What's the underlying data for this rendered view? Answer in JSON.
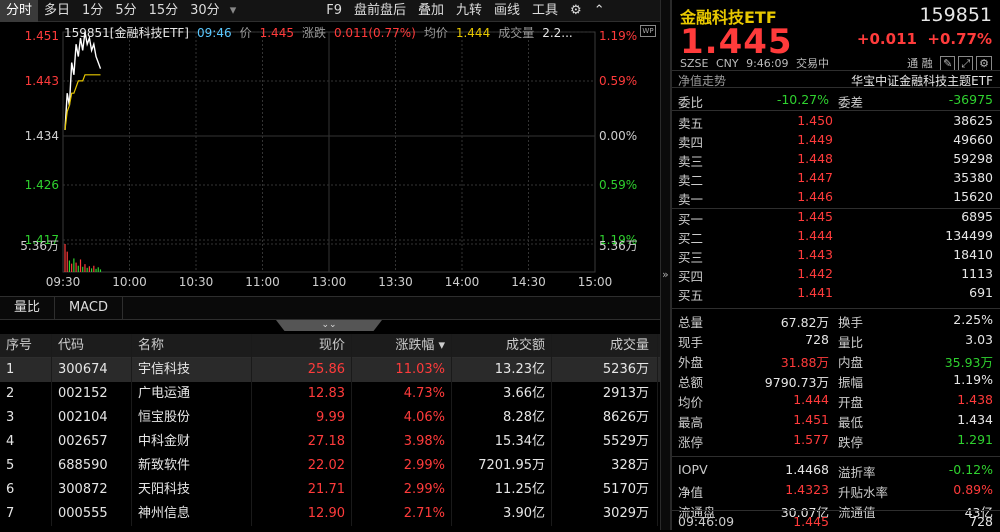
{
  "toolbar": {
    "items": [
      "分时",
      "多日",
      "1分",
      "5分",
      "15分",
      "30分",
      "▾",
      "F9",
      "盘前盘后",
      "叠加",
      "九转",
      "画线",
      "工具"
    ]
  },
  "chart": {
    "info": {
      "name": "159851[金融科技ETF]",
      "time": "09:46",
      "price_label": "价",
      "price": "1.445",
      "chg_label": "涨跌",
      "chg": "0.011(0.77%)",
      "avg_label": "均价",
      "avg": "1.444",
      "vol_label": "成交量",
      "vol": "2.2..."
    },
    "y_left": [
      "1.451",
      "1.443",
      "1.434",
      "1.426",
      "1.417",
      "5.36万"
    ],
    "y_right": [
      "1.19%",
      "0.59%",
      "0.00%",
      "0.59%",
      "1.19%",
      "5.36万"
    ],
    "x_labels": [
      "09:30",
      "10:00",
      "10:30",
      "11:00",
      "13:00",
      "13:30",
      "14:00",
      "14:30",
      "15:00"
    ],
    "wp_label": "WP"
  },
  "chart_data": {
    "type": "line",
    "x": [
      "09:30",
      "09:31",
      "09:32",
      "09:33",
      "09:34",
      "09:35",
      "09:36",
      "09:37",
      "09:38",
      "09:39",
      "09:40",
      "09:41",
      "09:42",
      "09:43",
      "09:44",
      "09:45",
      "09:46"
    ],
    "series": [
      {
        "name": "价",
        "values": [
          1.435,
          1.441,
          1.439,
          1.446,
          1.444,
          1.449,
          1.447,
          1.45,
          1.448,
          1.451,
          1.449,
          1.45,
          1.448,
          1.449,
          1.447,
          1.446,
          1.445
        ]
      },
      {
        "name": "均价",
        "values": [
          1.435,
          1.438,
          1.439,
          1.441,
          1.441,
          1.442,
          1.443,
          1.443,
          1.443,
          1.444,
          1.444,
          1.444,
          1.444,
          1.444,
          1.444,
          1.444,
          1.444
        ]
      }
    ],
    "volume": [
      5.36,
      3.9,
      2.2,
      1.6,
      2.6,
      1.8,
      1.2,
      2.4,
      1.0,
      1.5,
      0.8,
      1.1,
      0.7,
      1.2,
      0.6,
      0.9,
      0.5
    ],
    "ylim": [
      1.417,
      1.451
    ],
    "x_ticks": [
      "09:30",
      "10:00",
      "10:30",
      "11:00",
      "13:00",
      "13:30",
      "14:00",
      "14:30",
      "15:00"
    ],
    "colors": {
      "price": "#ffffff",
      "avg": "#e8c800",
      "up": "#ff3b3b",
      "down": "#2fd12f"
    }
  },
  "tabs": [
    "量比",
    "MACD"
  ],
  "table": {
    "headers": [
      "序号",
      "代码",
      "名称",
      "现价",
      "涨跌幅 ▾",
      "成交额",
      "成交量"
    ],
    "rows": [
      [
        "1",
        "300674",
        "宇信科技",
        "25.86",
        "11.03%",
        "13.23亿",
        "5236万"
      ],
      [
        "2",
        "002152",
        "广电运通",
        "12.83",
        "4.73%",
        "3.66亿",
        "2913万"
      ],
      [
        "3",
        "002104",
        "恒宝股份",
        "9.99",
        "4.06%",
        "8.28亿",
        "8626万"
      ],
      [
        "4",
        "002657",
        "中科金财",
        "27.18",
        "3.98%",
        "15.34亿",
        "5529万"
      ],
      [
        "5",
        "688590",
        "新致软件",
        "22.02",
        "2.99%",
        "7201.95万",
        "328万"
      ],
      [
        "6",
        "300872",
        "天阳科技",
        "21.71",
        "2.99%",
        "11.25亿",
        "5170万"
      ],
      [
        "7",
        "000555",
        "神州信息",
        "12.90",
        "2.71%",
        "3.90亿",
        "3029万"
      ]
    ]
  },
  "quote": {
    "title": "金融科技ETF",
    "code": "159851",
    "price": "1.445",
    "chg": "+0.011",
    "pct": "+0.77%",
    "meta": "SZSE CNY 9:46:09 交易中",
    "meta2": "通 融",
    "bar_left": "净值走势",
    "bar_right": "华宝中证金融科技主题ETF"
  },
  "weibi": {
    "k1": "委比",
    "v1": "-10.27%",
    "k2": "委差",
    "v2": "-36975"
  },
  "asks": [
    {
      "label": "卖五",
      "price": "1.450",
      "vol": "38625"
    },
    {
      "label": "卖四",
      "price": "1.449",
      "vol": "49660"
    },
    {
      "label": "卖三",
      "price": "1.448",
      "vol": "59298"
    },
    {
      "label": "卖二",
      "price": "1.447",
      "vol": "35380"
    },
    {
      "label": "卖一",
      "price": "1.446",
      "vol": "15620"
    }
  ],
  "bids": [
    {
      "label": "买一",
      "price": "1.445",
      "vol": "6895"
    },
    {
      "label": "买二",
      "price": "1.444",
      "vol": "134499"
    },
    {
      "label": "买三",
      "price": "1.443",
      "vol": "18410"
    },
    {
      "label": "买四",
      "price": "1.442",
      "vol": "1113"
    },
    {
      "label": "买五",
      "price": "1.441",
      "vol": "691"
    }
  ],
  "stats": [
    {
      "k1": "总量",
      "v1": "67.82万",
      "c1": "white",
      "k2": "换手",
      "v2": "2.25%",
      "c2": "white"
    },
    {
      "k1": "现手",
      "v1": "728",
      "c1": "white",
      "k2": "量比",
      "v2": "3.03",
      "c2": "white"
    },
    {
      "k1": "外盘",
      "v1": "31.88万",
      "c1": "red",
      "k2": "内盘",
      "v2": "35.93万",
      "c2": "green"
    },
    {
      "k1": "总额",
      "v1": "9790.73万",
      "c1": "white",
      "k2": "振幅",
      "v2": "1.19%",
      "c2": "white"
    },
    {
      "k1": "均价",
      "v1": "1.444",
      "c1": "red",
      "k2": "开盘",
      "v2": "1.438",
      "c2": "red"
    },
    {
      "k1": "最高",
      "v1": "1.451",
      "c1": "red",
      "k2": "最低",
      "v2": "1.434",
      "c2": "white"
    },
    {
      "k1": "涨停",
      "v1": "1.577",
      "c1": "red",
      "k2": "跌停",
      "v2": "1.291",
      "c2": "green"
    },
    {
      "k1": "IOPV",
      "v1": "1.4468",
      "c1": "white",
      "k2": "溢折率",
      "v2": "-0.12%",
      "c2": "green"
    },
    {
      "k1": "净值",
      "v1": "1.4323",
      "c1": "red",
      "k2": "升贴水率",
      "v2": "0.89%",
      "c2": "red"
    },
    {
      "k1": "流通盘",
      "v1": "30.07亿",
      "c1": "white",
      "k2": "流通值",
      "v2": "43亿",
      "c2": "white"
    }
  ],
  "tick": {
    "time": "09:46:09",
    "price": "1.445",
    "vol": "728"
  }
}
